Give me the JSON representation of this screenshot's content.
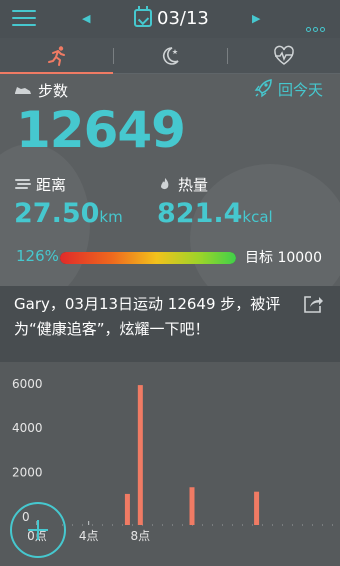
{
  "header": {
    "date": "03/13",
    "prev_icon": "triangle-left-icon",
    "next_icon": "triangle-right-icon",
    "menu_icon": "hamburger-icon",
    "more_icon": "more-dots-icon",
    "calendar_icon": "calendar-check-icon"
  },
  "tabs": [
    {
      "icon": "running-icon",
      "active": true
    },
    {
      "icon": "moon-star-icon",
      "active": false
    },
    {
      "icon": "heart-pulse-icon",
      "active": false
    }
  ],
  "steps": {
    "label": "步数",
    "value": "12649",
    "today_button": "回今天"
  },
  "distance": {
    "label": "距离",
    "value": "27.50",
    "unit": "km"
  },
  "calories": {
    "label": "热量",
    "value": "821.4",
    "unit": "kcal"
  },
  "progress": {
    "percent_text": "126%",
    "fraction": 1.0,
    "goal_text": "目标 10000"
  },
  "share": {
    "text": "Gary，03月13日运动 12649 步，被评为“健康追客”，炫耀一下吧！"
  },
  "colors": {
    "accent": "#46c8cf",
    "tab_active": "#f07b64",
    "bar": "#f07b64"
  },
  "chart_data": {
    "type": "bar",
    "x": [
      7,
      8,
      12,
      17
    ],
    "values": [
      1400,
      6300,
      1700,
      1500
    ],
    "yticks": [
      0,
      2000,
      4000,
      6000
    ],
    "xtick_labels": [
      "0点",
      "4点",
      "8点"
    ],
    "xtick_values": [
      0,
      4,
      8
    ],
    "xlim": [
      0,
      24
    ],
    "ylim": [
      0,
      6800
    ]
  }
}
